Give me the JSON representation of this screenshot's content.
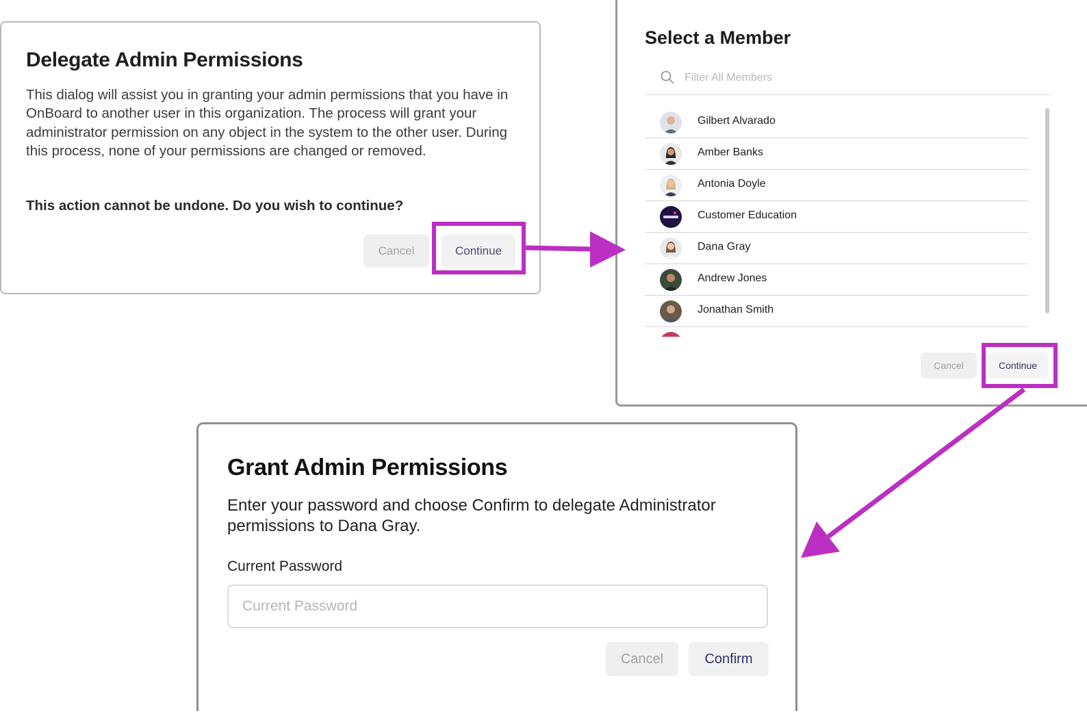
{
  "accent_color": "#bb2fc2",
  "delegate_dialog": {
    "title": "Delegate Admin Permissions",
    "body": "This dialog will assist you in granting your admin permissions that you have in OnBoard to another user in this organization. The process will grant your administrator permission on any object in the system to the other user. During this process, none of your permissions are changed or removed.",
    "warning": "This action cannot be undone. Do you wish to continue?",
    "cancel_label": "Cancel",
    "continue_label": "Continue"
  },
  "select_member_dialog": {
    "title": "Select a Member",
    "search": {
      "icon": "search-icon",
      "placeholder": "Filter All Members"
    },
    "members": [
      {
        "name": "Gilbert Alvarado",
        "avatar": "photo"
      },
      {
        "name": "Amber Banks",
        "avatar": "photo"
      },
      {
        "name": "Antonia Doyle",
        "avatar": "photo"
      },
      {
        "name": "Customer Education",
        "avatar": "onboard-logo"
      },
      {
        "name": "Dana Gray",
        "avatar": "photo"
      },
      {
        "name": "Andrew Jones",
        "avatar": "photo"
      },
      {
        "name": "Jonathan Smith",
        "avatar": "photo"
      }
    ],
    "cancel_label": "Cancel",
    "continue_label": "Continue"
  },
  "grant_dialog": {
    "title": "Grant Admin Permissions",
    "body": "Enter your password and choose Confirm to delegate Administrator permissions to Dana Gray.",
    "password_label": "Current Password",
    "password_placeholder": "Current Password",
    "cancel_label": "Cancel",
    "confirm_label": "Confirm"
  }
}
